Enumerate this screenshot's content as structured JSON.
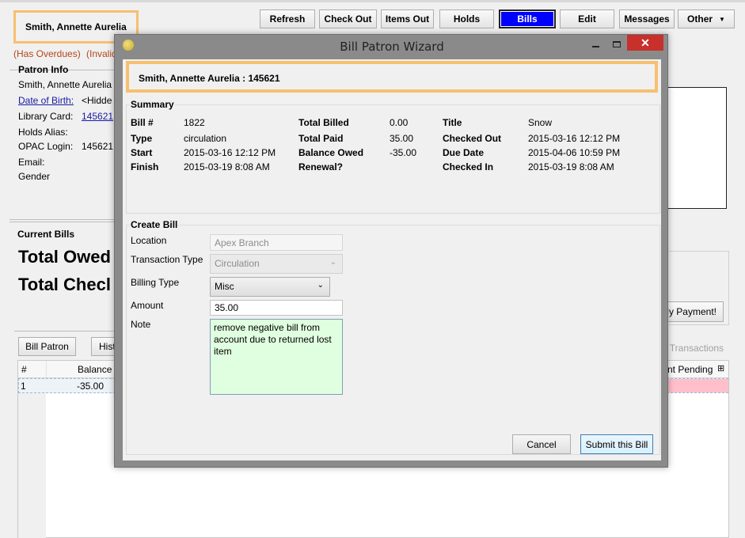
{
  "header": {
    "patron_name": "Smith, Annette Aurelia",
    "alerts": [
      "(Has Overdues)",
      "(Invalid"
    ]
  },
  "toolbar": {
    "refresh": "Refresh",
    "check_out": "Check Out",
    "items_out": "Items Out",
    "holds": "Holds",
    "bills": "Bills",
    "edit": "Edit",
    "messages": "Messages",
    "other": "Other",
    "active": "Bills"
  },
  "patron_info": {
    "title": "Patron Info",
    "name": "Smith, Annette Aurelia",
    "dob_label": "Date of Birth:",
    "dob_value": "<Hidde",
    "card_label": "Library Card:",
    "card_value": "145621",
    "holds_alias_label": "Holds Alias:",
    "opac_label": "OPAC Login:",
    "opac_value": "145621",
    "email_label": "Email:",
    "gender_label": "Gender"
  },
  "current_bills": {
    "title": "Current Bills",
    "total_owed": "Total Owed",
    "total_checked": "Total Checl",
    "apply_payment": "ly Payment!",
    "bill_patron": "Bill Patron",
    "history_partial": "Hist",
    "transactions_partial": "d Transactions",
    "grid": {
      "columns": [
        "#",
        "Balance O",
        "nt Pending"
      ],
      "rows": [
        {
          "num": "1",
          "balance": "-35.00"
        }
      ]
    }
  },
  "dialog": {
    "title": "Bill Patron Wizard",
    "header": "Smith, Annette Aurelia  : 145621",
    "summary": {
      "title": "Summary",
      "bill_no_label": "Bill #",
      "bill_no": "1822",
      "type_label": "Type",
      "type": "circulation",
      "start_label": "Start",
      "start": "2015-03-16 12:12 PM",
      "finish_label": "Finish",
      "finish": "2015-03-19 8:08 AM",
      "total_billed_label": "Total Billed",
      "total_billed": "0.00",
      "total_paid_label": "Total Paid",
      "total_paid": "35.00",
      "balance_owed_label": "Balance Owed",
      "balance_owed": "-35.00",
      "renewal_label": "Renewal?",
      "title_label": "Title",
      "title_value": "Snow",
      "checked_out_label": "Checked Out",
      "checked_out": "2015-03-16 12:12 PM",
      "due_date_label": "Due Date",
      "due_date": "2015-04-06 10:59 PM",
      "checked_in_label": "Checked In",
      "checked_in": "2015-03-19 8:08 AM"
    },
    "create_bill": {
      "title": "Create Bill",
      "location_label": "Location",
      "location": "Apex Branch",
      "transaction_type_label": "Transaction Type",
      "transaction_type": "Circulation",
      "billing_type_label": "Billing Type",
      "billing_type": "Misc",
      "amount_label": "Amount",
      "amount": "35.00",
      "note_label": "Note",
      "note": "remove negative bill from account due to returned lost item"
    },
    "cancel": "Cancel",
    "submit": "Submit this Bill"
  },
  "colors": {
    "highlight_border": "#f7c070",
    "active_tab": "#0000ff",
    "alert_text": "#b5461a",
    "note_bg": "#e0ffe0",
    "close_button": "#c7302b",
    "pending_row": "#ffc0cb"
  }
}
